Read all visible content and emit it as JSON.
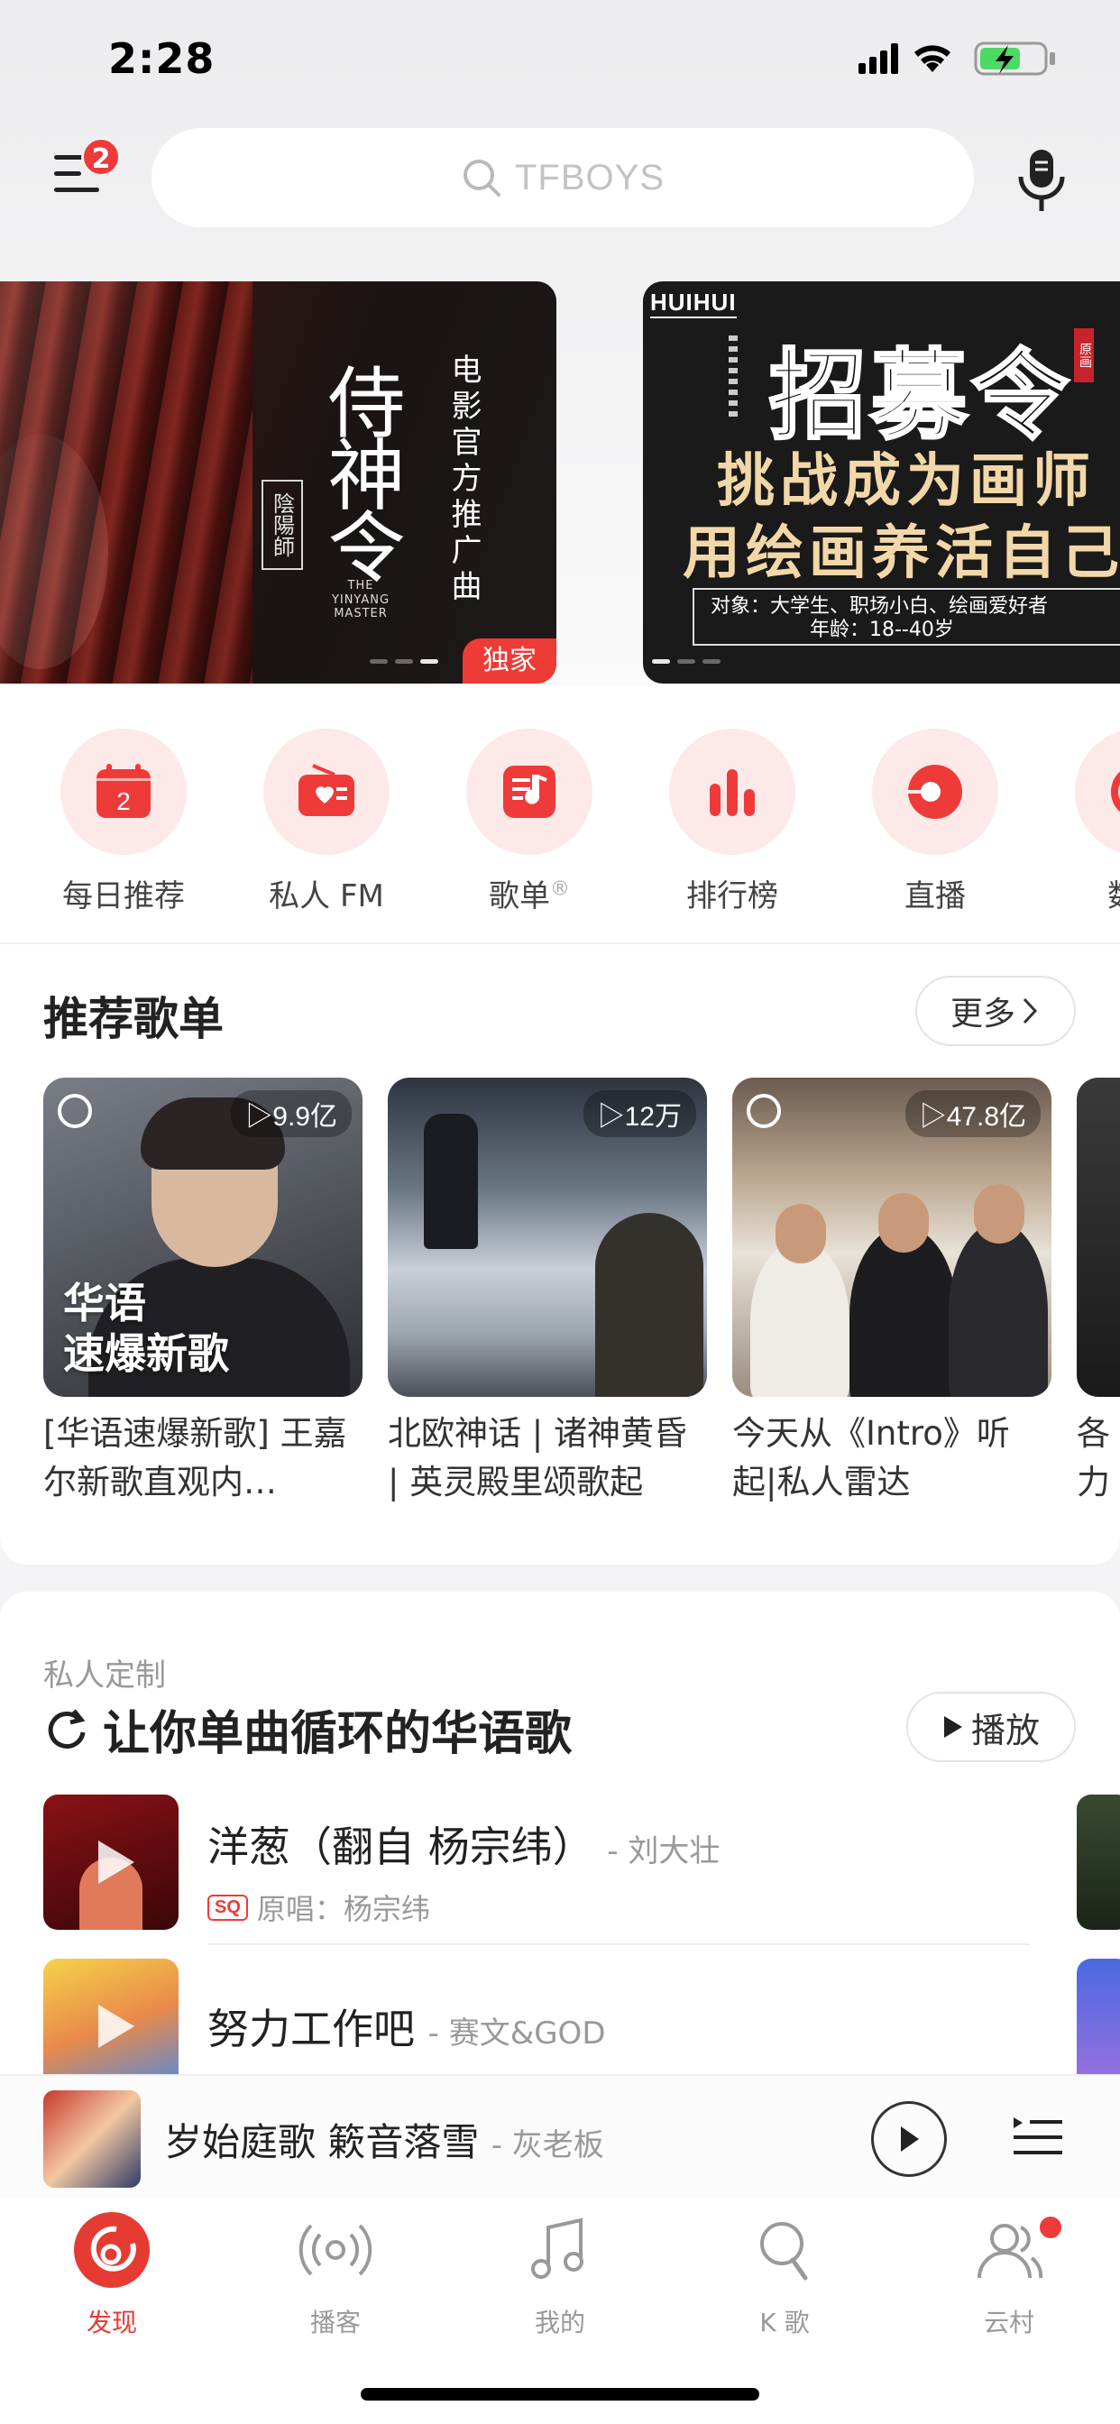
{
  "status": {
    "time": "2:28"
  },
  "header": {
    "menu_badge": "2",
    "search_placeholder": "TFBOYS"
  },
  "banners": [
    {
      "title": "侍神令",
      "subtitle": "电影官方推广曲",
      "seal": "陰陽師",
      "english": "THE YINYANG MASTER",
      "tag": "独家"
    },
    {
      "logo": "HUIHUI",
      "big": "招募令",
      "red_tag": "原画",
      "line1": "挑战成为画师",
      "line2": "用绘画养活自己",
      "box_line1": "对象：大学生、职场小白、绘画爱好者",
      "box_line2": "年龄：18--40岁"
    }
  ],
  "quick_entries": [
    {
      "label": "每日推荐",
      "icon": "calendar-icon",
      "day": "2"
    },
    {
      "label": "私人 FM",
      "icon": "radio-icon"
    },
    {
      "label": "歌单",
      "sup": "®",
      "icon": "playlist-icon"
    },
    {
      "label": "排行榜",
      "icon": "chart-icon"
    },
    {
      "label": "直播",
      "icon": "live-icon"
    },
    {
      "label": "数字",
      "icon": "digital-icon"
    }
  ],
  "recommend": {
    "title": "推荐歌单",
    "more": "更多",
    "playlists": [
      {
        "count": "9.9亿",
        "cover_text_1": "华语",
        "cover_text_2": "速爆新歌",
        "name": "[华语速爆新歌] 王嘉尔新歌直观内…"
      },
      {
        "count": "12万",
        "name": "北欧神话 | 诸神黄昏 | 英灵殿里颂歌起"
      },
      {
        "count": "47.8亿",
        "name": "今天从《Intro》听起|私人雷达"
      },
      {
        "name": "各力英,"
      }
    ]
  },
  "private": {
    "label": "私人定制",
    "title": "让你单曲循环的华语歌",
    "play": "播放",
    "songs": [
      {
        "title": "洋葱（翻自 杨宗纬）",
        "artist": "- 刘大壮",
        "quality": "SQ",
        "original": "原唱：杨宗纬"
      },
      {
        "title": "努力工作吧",
        "artist": "- 赛文&GOD"
      }
    ]
  },
  "player": {
    "title": "岁始庭歌 簌音落雪",
    "artist": "- 灰老板"
  },
  "tabs": [
    {
      "label": "发现",
      "icon": "discover-icon",
      "active": true
    },
    {
      "label": "播客",
      "icon": "podcast-icon"
    },
    {
      "label": "我的",
      "icon": "music-note-icon"
    },
    {
      "label": "K 歌",
      "icon": "karaoke-icon"
    },
    {
      "label": "云村",
      "icon": "community-icon"
    }
  ],
  "colors": {
    "accent": "#ef3a3a",
    "icon_bg": "#fde9e8"
  }
}
